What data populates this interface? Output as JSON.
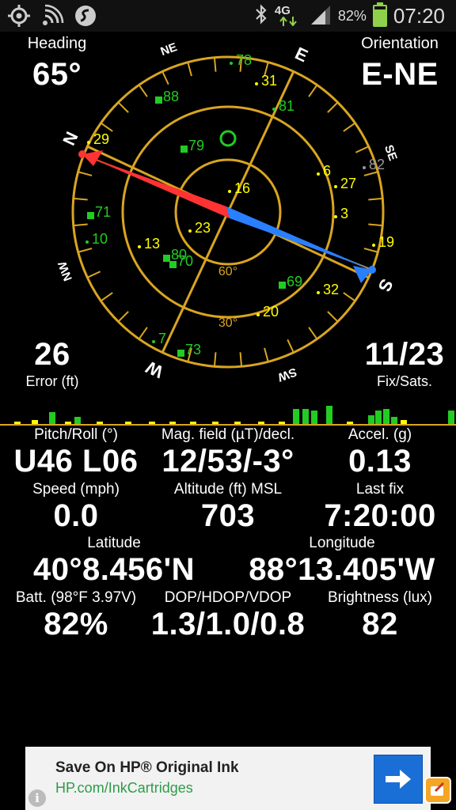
{
  "status_bar": {
    "battery_text": "82%",
    "battery_level": 0.82,
    "time": "07:20",
    "network_label": "4G",
    "icons": [
      "gps-icon",
      "wifi-signal-icon",
      "app-icon",
      "bluetooth-icon",
      "network-4g-icon",
      "cell-signal-icon",
      "battery-icon"
    ]
  },
  "header": {
    "heading_label": "Heading",
    "heading_value": "65°",
    "orientation_label": "Orientation",
    "orientation_value": "E-NE"
  },
  "compass": {
    "directions": {
      "N": "N",
      "NE": "NE",
      "E": "E",
      "SE": "SE",
      "S": "S",
      "SW": "SW",
      "W": "W",
      "NW": "NW"
    },
    "ring_labels": [
      "60°",
      "30°"
    ],
    "satellites": [
      {
        "id": "78",
        "color": "#22cc22"
      },
      {
        "id": "31",
        "color": "#ffff00"
      },
      {
        "id": "88",
        "color": "#22cc22"
      },
      {
        "id": "81",
        "color": "#22cc22"
      },
      {
        "id": "29",
        "color": "#ffff00"
      },
      {
        "id": "79",
        "color": "#22cc22"
      },
      {
        "id": "6",
        "color": "#ffff00"
      },
      {
        "id": "82",
        "color": "#999999"
      },
      {
        "id": "27",
        "color": "#ffff00"
      },
      {
        "id": "16",
        "color": "#ffff00"
      },
      {
        "id": "71",
        "color": "#22cc22"
      },
      {
        "id": "3",
        "color": "#ffff00"
      },
      {
        "id": "23",
        "color": "#ffff00"
      },
      {
        "id": "10",
        "color": "#22cc22"
      },
      {
        "id": "13",
        "color": "#ffff00"
      },
      {
        "id": "80",
        "color": "#22cc22"
      },
      {
        "id": "70",
        "color": "#22cc22"
      },
      {
        "id": "19",
        "color": "#ffff00"
      },
      {
        "id": "69",
        "color": "#22cc22"
      },
      {
        "id": "32",
        "color": "#ffff00"
      },
      {
        "id": "20",
        "color": "#ffff00"
      },
      {
        "id": "7",
        "color": "#22cc22"
      },
      {
        "id": "73",
        "color": "#22cc22"
      }
    ]
  },
  "fix": {
    "error_value": "26",
    "error_label": "Error (ft)",
    "fix_value": "11/23",
    "fix_label": "Fix/Sats."
  },
  "stats": {
    "pitch_roll_label": "Pitch/Roll (°)",
    "pitch_roll_value": "U46 L06",
    "mag_label": "Mag. field (µT)/decl.",
    "mag_value": "12/53/-3°",
    "accel_label": "Accel. (g)",
    "accel_value": "0.13",
    "speed_label": "Speed (mph)",
    "speed_value": "0.0",
    "altitude_label": "Altitude (ft) MSL",
    "altitude_value": "703",
    "lastfix_label": "Last fix",
    "lastfix_value": "7:20:00",
    "latitude_label": "Latitude",
    "latitude_value": "40°8.456'N",
    "longitude_label": "Longitude",
    "longitude_value": "88°13.405'W",
    "batt_label": "Batt. (98°F 3.97V)",
    "batt_value": "82%",
    "dop_label": "DOP/HDOP/VDOP",
    "dop_value": "1.3/1.0/0.8",
    "brightness_label": "Brightness (lux)",
    "brightness_value": "82"
  },
  "ad": {
    "title": "Save On HP® Original Ink",
    "url": "HP.com/InkCartridges",
    "info_symbol": "i"
  },
  "colors": {
    "ring": "#d9a520",
    "sat_green": "#22cc22",
    "sat_yellow": "#ffff00",
    "needle_red": "#ff3333",
    "needle_blue": "#2a7fff"
  }
}
